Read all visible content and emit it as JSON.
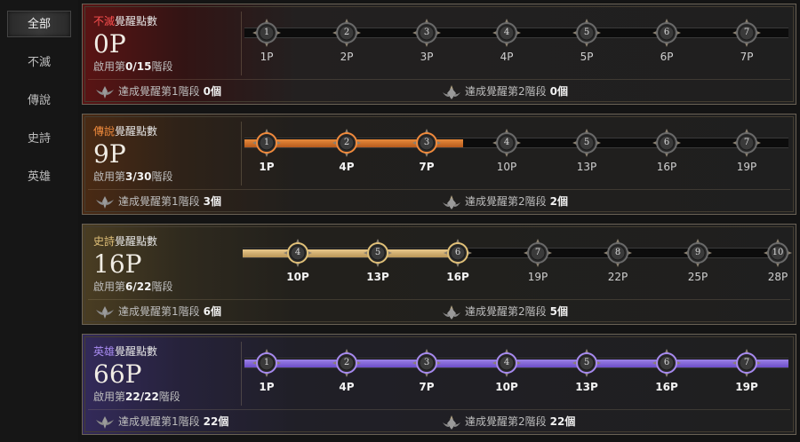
{
  "sidebar": {
    "items": [
      {
        "label": "全部",
        "active": true
      },
      {
        "label": "不滅",
        "active": false
      },
      {
        "label": "傳說",
        "active": false
      },
      {
        "label": "史詩",
        "active": false
      },
      {
        "label": "英雄",
        "active": false
      }
    ]
  },
  "panels": [
    {
      "tier": "不滅",
      "title_suffix": "覺醒點數",
      "points": "0P",
      "stage_prefix": "啟用第",
      "stage_value": "0/15",
      "stage_suffix": "階段",
      "fill_fraction": 0,
      "nodes": [
        "1",
        "2",
        "3",
        "4",
        "5",
        "6",
        "7"
      ],
      "labels": [
        "1P",
        "2P",
        "3P",
        "4P",
        "5P",
        "6P",
        "7P"
      ],
      "active_count": 0,
      "stage1_text": "達成覺醒第1階段",
      "stage1_count": "0個",
      "stage2_text": "達成覺醒第2階段",
      "stage2_count": "0個"
    },
    {
      "tier": "傳說",
      "title_suffix": "覺醒點數",
      "points": "9P",
      "stage_prefix": "啟用第",
      "stage_value": "3/30",
      "stage_suffix": "階段",
      "fill_fraction": 0.42,
      "nodes": [
        "1",
        "2",
        "3",
        "4",
        "5",
        "6",
        "7"
      ],
      "labels": [
        "1P",
        "4P",
        "7P",
        "10P",
        "13P",
        "16P",
        "19P"
      ],
      "active_count": 3,
      "stage1_text": "達成覺醒第1階段",
      "stage1_count": "3個",
      "stage2_text": "達成覺醒第2階段",
      "stage2_count": "2個"
    },
    {
      "tier": "史詩",
      "title_suffix": "覺醒點數",
      "points": "16P",
      "stage_prefix": "啟用第",
      "stage_value": "6/22",
      "stage_suffix": "階段",
      "fill_fraction": 0.4,
      "nodes": [
        "4",
        "5",
        "6",
        "7",
        "8",
        "9",
        "10"
      ],
      "labels": [
        "10P",
        "13P",
        "16P",
        "19P",
        "22P",
        "25P",
        "28P"
      ],
      "active_count": 3,
      "stage1_text": "達成覺醒第1階段",
      "stage1_count": "6個",
      "stage2_text": "達成覺醒第2階段",
      "stage2_count": "5個"
    },
    {
      "tier": "英雄",
      "title_suffix": "覺醒點數",
      "points": "66P",
      "stage_prefix": "啟用第",
      "stage_value": "22/22",
      "stage_suffix": "階段",
      "fill_fraction": 1,
      "nodes": [
        "1",
        "2",
        "3",
        "4",
        "5",
        "6",
        "7"
      ],
      "labels": [
        "1P",
        "4P",
        "7P",
        "10P",
        "13P",
        "16P",
        "19P"
      ],
      "active_count": 7,
      "stage1_text": "達成覺醒第1階段",
      "stage1_count": "22個",
      "stage2_text": "達成覺醒第2階段",
      "stage2_count": "22個"
    }
  ],
  "colors": {
    "immortal": "#ff5050",
    "legend": "#f08a3c",
    "epic": "#e0c078",
    "hero": "#a78af0"
  },
  "icons": {
    "node": "compass-medallion-icon",
    "stage1": "winged-crest-icon",
    "stage2": "flame-crest-icon"
  }
}
